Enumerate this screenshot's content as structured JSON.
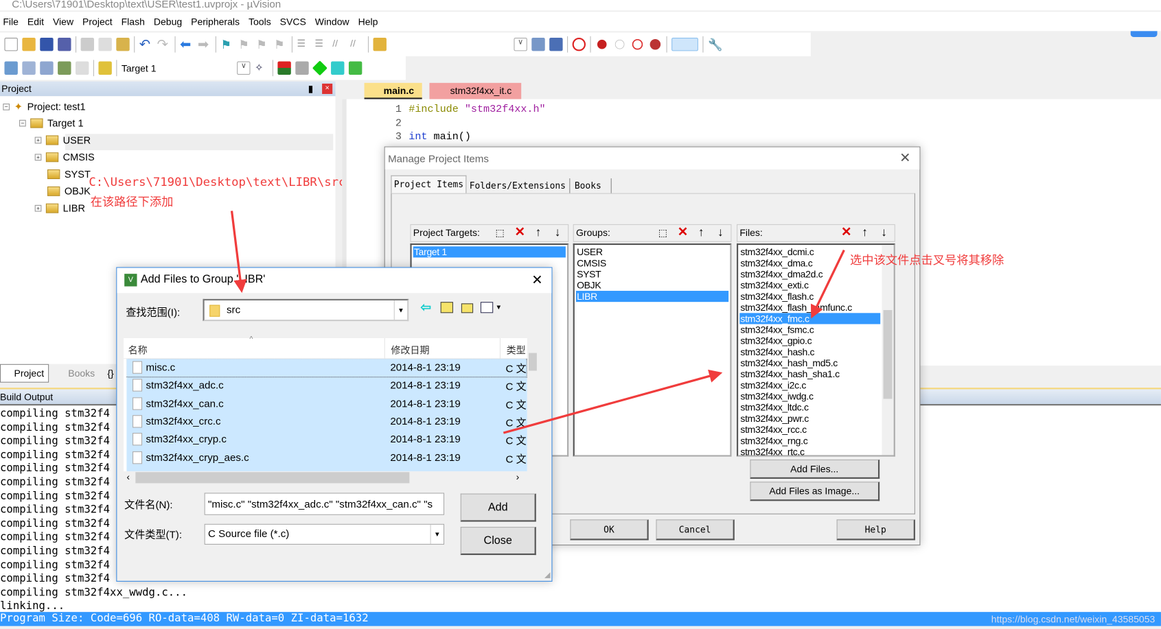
{
  "window": {
    "title": "C:\\Users\\71901\\Desktop\\text\\USER\\test1.uvprojx - µVision"
  },
  "menu": [
    "File",
    "Edit",
    "View",
    "Project",
    "Flash",
    "Debug",
    "Peripherals",
    "Tools",
    "SVCS",
    "Window",
    "Help"
  ],
  "toolbar2": {
    "target": "Target 1"
  },
  "project_panel": {
    "title": "Project",
    "tree": {
      "project": "Project: test1",
      "target": "Target 1",
      "groups": [
        "USER",
        "CMSIS",
        "SYST",
        "OBJK",
        "LIBR"
      ]
    }
  },
  "editor": {
    "tabs": [
      "main.c",
      "stm32f4xx_it.c"
    ],
    "lines": [
      {
        "n": "1",
        "code": "#include \"stm32f4xx.h\""
      },
      {
        "n": "2",
        "code": ""
      },
      {
        "n": "3",
        "code": "int main()"
      }
    ]
  },
  "left_tabs": [
    "Project",
    "Books",
    "{}"
  ],
  "build_output": {
    "title": "Build Output",
    "lines": [
      "compiling stm32f4",
      "compiling stm32f4",
      "compiling stm32f4",
      "compiling stm32f4",
      "compiling stm32f4",
      "compiling stm32f4",
      "compiling stm32f4",
      "compiling stm32f4",
      "compiling stm32f4",
      "compiling stm32f4",
      "compiling stm32f4",
      "compiling stm32f4",
      "compiling stm32f4",
      "compiling stm32f4xx_wwdg.c...",
      "linking..."
    ],
    "program_size": "Program Size: Code=696 RO-data=408 RW-data=0 ZI-data=1632"
  },
  "watermark": "https://blog.csdn.net/weixin_43585053",
  "annotations": {
    "path": "C:\\Users\\71901\\Desktop\\text\\LIBR\\src",
    "path_note": "在该路径下添加",
    "remove_note": "选中该文件点击叉号将其移除"
  },
  "manage_dialog": {
    "title": "Manage Project Items",
    "tabs": [
      "Project Items",
      "Folders/Extensions",
      "Books"
    ],
    "targets_label": "Project Targets:",
    "targets": [
      "Target 1"
    ],
    "groups_label": "Groups:",
    "groups": [
      "USER",
      "CMSIS",
      "SYST",
      "OBJK",
      "LIBR"
    ],
    "selected_group": "LIBR",
    "files_label": "Files:",
    "files": [
      "stm32f4xx_dcmi.c",
      "stm32f4xx_dma.c",
      "stm32f4xx_dma2d.c",
      "stm32f4xx_exti.c",
      "stm32f4xx_flash.c",
      "stm32f4xx_flash_ramfunc.c",
      "stm32f4xx_fmc.c",
      "stm32f4xx_fsmc.c",
      "stm32f4xx_gpio.c",
      "stm32f4xx_hash.c",
      "stm32f4xx_hash_md5.c",
      "stm32f4xx_hash_sha1.c",
      "stm32f4xx_i2c.c",
      "stm32f4xx_iwdg.c",
      "stm32f4xx_ltdc.c",
      "stm32f4xx_pwr.c",
      "stm32f4xx_rcc.c",
      "stm32f4xx_rng.c",
      "stm32f4xx_rtc.c"
    ],
    "selected_file": "stm32f4xx_fmc.c",
    "add_files": "Add Files...",
    "add_files_image": "Add Files as Image...",
    "ok": "OK",
    "cancel": "Cancel",
    "help": "Help"
  },
  "add_dialog": {
    "title": "Add Files to Group 'LIBR'",
    "lookin_label": "查找范围(I):",
    "lookin_value": "src",
    "columns": [
      "名称",
      "修改日期",
      "类型"
    ],
    "files": [
      {
        "name": "misc.c",
        "date": "2014-8-1 23:19",
        "type": "C 文"
      },
      {
        "name": "stm32f4xx_adc.c",
        "date": "2014-8-1 23:19",
        "type": "C 文"
      },
      {
        "name": "stm32f4xx_can.c",
        "date": "2014-8-1 23:19",
        "type": "C 文"
      },
      {
        "name": "stm32f4xx_crc.c",
        "date": "2014-8-1 23:19",
        "type": "C 文"
      },
      {
        "name": "stm32f4xx_cryp.c",
        "date": "2014-8-1 23:19",
        "type": "C 文"
      },
      {
        "name": "stm32f4xx_cryp_aes.c",
        "date": "2014-8-1 23:19",
        "type": "C 文"
      }
    ],
    "filename_label": "文件名(N):",
    "filename_value": "\"misc.c\" \"stm32f4xx_adc.c\" \"stm32f4xx_can.c\" \"s",
    "filetype_label": "文件类型(T):",
    "filetype_value": "C Source file (*.c)",
    "add": "Add",
    "close": "Close"
  },
  "colors": {
    "selection": "#3399ff",
    "annotation": "#f03c3c",
    "list_selected": "#cce8ff"
  }
}
